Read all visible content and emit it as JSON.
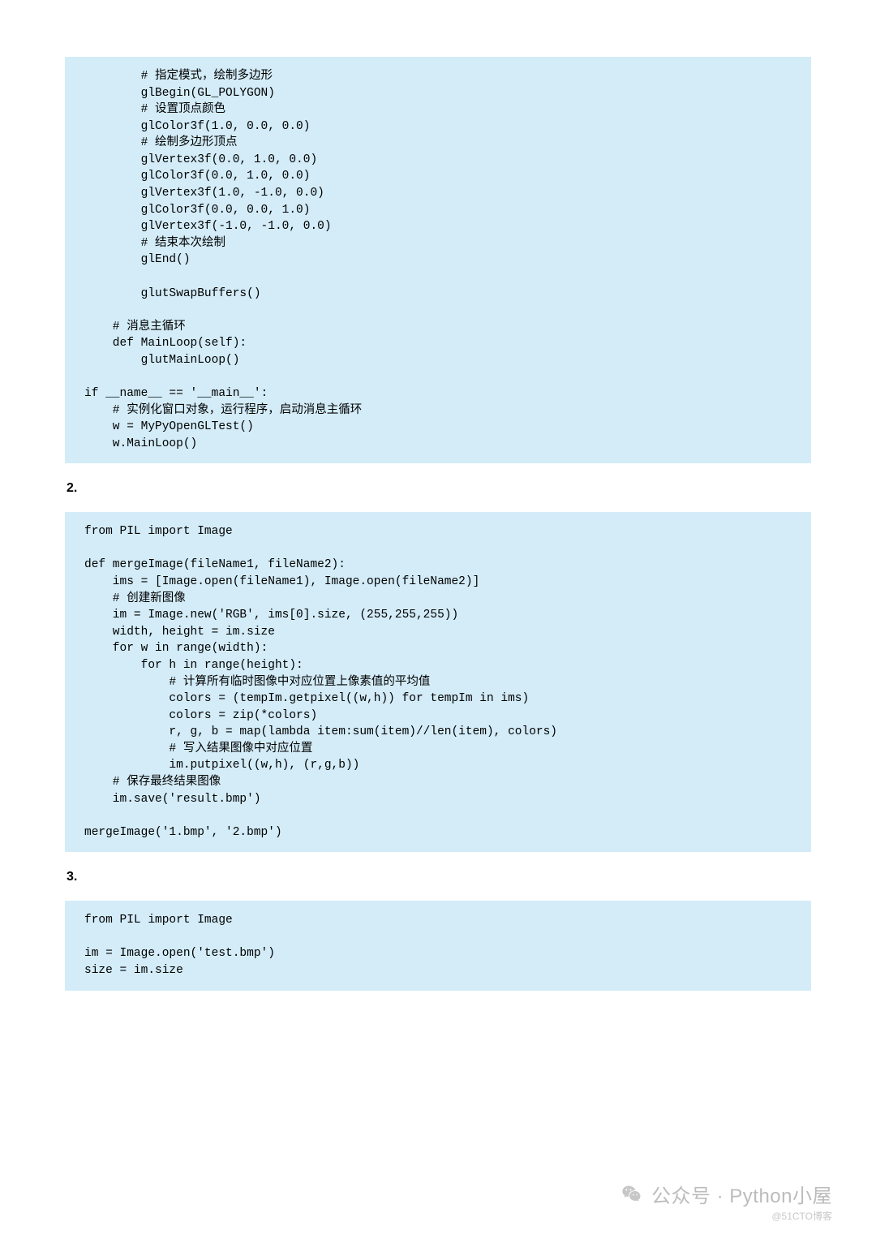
{
  "blocks": {
    "code1": "        # 指定模式，绘制多边形\n        glBegin(GL_POLYGON)\n        # 设置顶点颜色\n        glColor3f(1.0, 0.0, 0.0)\n        # 绘制多边形顶点\n        glVertex3f(0.0, 1.0, 0.0)\n        glColor3f(0.0, 1.0, 0.0)\n        glVertex3f(1.0, -1.0, 0.0)\n        glColor3f(0.0, 0.0, 1.0)\n        glVertex3f(-1.0, -1.0, 0.0)\n        # 结束本次绘制\n        glEnd()\n\n        glutSwapBuffers()\n\n    # 消息主循环\n    def MainLoop(self):\n        glutMainLoop()\n\nif __name__ == '__main__':\n    # 实例化窗口对象，运行程序，启动消息主循环\n    w = MyPyOpenGLTest()\n    w.MainLoop()",
    "section2": "2.",
    "code2": "from PIL import Image\n\ndef mergeImage(fileName1, fileName2):\n    ims = [Image.open(fileName1), Image.open(fileName2)]\n    # 创建新图像\n    im = Image.new('RGB', ims[0].size, (255,255,255))\n    width, height = im.size\n    for w in range(width):\n        for h in range(height):\n            # 计算所有临时图像中对应位置上像素值的平均值\n            colors = (tempIm.getpixel((w,h)) for tempIm in ims)\n            colors = zip(*colors)\n            r, g, b = map(lambda item:sum(item)//len(item), colors)\n            # 写入结果图像中对应位置\n            im.putpixel((w,h), (r,g,b))\n    # 保存最终结果图像\n    im.save('result.bmp')\n\nmergeImage('1.bmp', '2.bmp')",
    "section3": "3.",
    "code3": "from PIL import Image\n\nim = Image.open('test.bmp')\nsize = im.size"
  },
  "watermark": {
    "text": "公众号 · Python小屋",
    "sub": "@51CTO博客"
  }
}
